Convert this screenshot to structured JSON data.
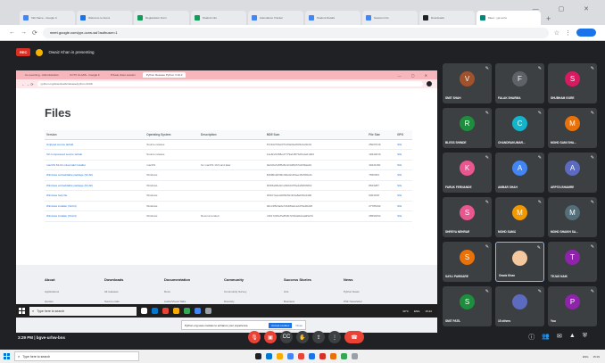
{
  "browser": {
    "tabs": [
      {
        "label": "Tab Name - Google C",
        "color": "#4285f4"
      },
      {
        "label": "Welcome to Arena",
        "color": "#1a73e8"
      },
      {
        "label": "Registration Form",
        "color": "#0f9d58"
      },
      {
        "label": "Student info",
        "color": "#0f9d58"
      },
      {
        "label": "Attendance Tracker",
        "color": "#4285f4"
      },
      {
        "label": "Student Details",
        "color": "#4285f4"
      },
      {
        "label": "Session Info",
        "color": "#4285f4"
      },
      {
        "label": "Downloads",
        "color": "#202124"
      },
      {
        "label": "Meet - ypr-ocrw",
        "color": "#00897b",
        "active": true
      }
    ],
    "url": "meet.google.com/ypr-ocrw-ssl?authuser=1"
  },
  "meet": {
    "rec_label": "REC",
    "presenting_text": "Owaiz Khan is presenting",
    "time_label": "3:29 PM | bgve-urhw-bns",
    "participants": [
      {
        "initial": "V",
        "name": "SMIT SHAH",
        "color": "#a0522d"
      },
      {
        "initial": "F",
        "name": "FALAK SHARMA",
        "color": "#5f6368"
      },
      {
        "initial": "S",
        "name": "SHUBHAM GORE",
        "color": "#d81b60"
      },
      {
        "initial": "R",
        "name": "BLESS SHINDE",
        "color": "#1e8e3e"
      },
      {
        "initial": "C",
        "name": "CHANDRAKUMAR...",
        "color": "#12b5cb"
      },
      {
        "initial": "M",
        "name": "MOHD SAMI SHA...",
        "color": "#e8710a"
      },
      {
        "initial": "K",
        "name": "FARUK FERNANDE",
        "color": "#e8578f"
      },
      {
        "initial": "A",
        "name": "AMBAR SHAH",
        "color": "#4285f4"
      },
      {
        "initial": "A",
        "name": "ARPITA BHAMRE",
        "color": "#5c6bc0"
      },
      {
        "initial": "S",
        "name": "SHREYA NEHRAR",
        "color": "#e8578f"
      },
      {
        "initial": "M",
        "name": "MOHD SAMIJ",
        "color": "#f29900"
      },
      {
        "initial": "M",
        "name": "MOHD SHAIKH SA...",
        "color": "#546e7a"
      },
      {
        "initial": "S",
        "name": "SAYLI PAWSARE",
        "color": "#e8710a"
      },
      {
        "initial": "",
        "name": "Owaiz Khan",
        "color": "#f5c9a0"
      },
      {
        "initial": "T",
        "name": "TEJAS NAIK",
        "color": "#8e24aa"
      },
      {
        "initial": "S",
        "name": "SMIT PATIL",
        "color": "#1e8e3e"
      },
      {
        "initial": "",
        "name": "15 others",
        "color": "#5c6bc0"
      },
      {
        "initial": "P",
        "name": "You",
        "color": "#8e24aa"
      }
    ]
  },
  "shared_screen": {
    "tabs": [
      {
        "label": "Co-Learning - Administration"
      },
      {
        "label": "CCTV CLASS - Google F"
      },
      {
        "label": "Private class session"
      },
      {
        "label": "Python Release Python 3.10.2",
        "active": true
      }
    ],
    "url": "python.org/downloads/release/python-3102/",
    "heading": "Files",
    "columns": [
      "Version",
      "Operating System",
      "Description",
      "MD5 Sum",
      "File Size",
      "GPG"
    ],
    "rows": [
      [
        "Gzipped source tarball",
        "Source release",
        "",
        "67c92270be6701f4a6fed003c2af3c01",
        "25007016",
        "SIG"
      ],
      [
        "XZ compressed source tarball",
        "Source release",
        "",
        "14e8c22458ed7779a1957b26cde01db9",
        "19342616",
        "SIG"
      ],
      [
        "macOS 64-bit universal2 installer",
        "macOS",
        "for macOS 10.9 and later",
        "0a3c0a7a5f5d6c4c3a5f2b7cd0f3aa91",
        "40441160",
        "SIG"
      ],
      [
        "Windows embeddable package (32-bit)",
        "Windows",
        "",
        "fb8d8bd2f36b4b6a0cc83ee45c8b5a11",
        "7656453",
        "SIG"
      ],
      [
        "Windows embeddable package (64-bit)",
        "Windows",
        "",
        "0f4b5ab8e9c1c9b04d7f6e4a63f0b6b2",
        "8633287",
        "SIG"
      ],
      [
        "Windows help file",
        "Windows",
        "",
        "3f41b7a1e3d0f9c6fc4b3a8ab54c2d90",
        "9364158",
        "SIG"
      ],
      [
        "Windows installer (32-bit)",
        "Windows",
        "",
        "0d1c3f5c3a6e72b4f8a4ce2d79a30d18",
        "27785192",
        "SIG"
      ],
      [
        "Windows installer (64-bit)",
        "Windows",
        "Recommended",
        "c3917c08a7fe85db7203da6dcaa99a70",
        "28991832",
        "SIG"
      ]
    ],
    "footer_columns": [
      {
        "title": "About",
        "links": [
          "Applications",
          "Quotes"
        ]
      },
      {
        "title": "Downloads",
        "links": [
          "All releases",
          "Source code"
        ]
      },
      {
        "title": "Documentation",
        "links": [
          "Docs",
          "Audio/Visual Talks"
        ]
      },
      {
        "title": "Community",
        "links": [
          "Community Survey",
          "Diversity"
        ]
      },
      {
        "title": "Success Stories",
        "links": [
          "Arts",
          "Business"
        ]
      },
      {
        "title": "News",
        "links": [
          "Python News",
          "PSF Newsletter"
        ]
      }
    ],
    "cookie_text": "Python.org uses cookies to enhance your experience.",
    "cookie_accept": "Accept cookies",
    "cookie_close": "Close",
    "taskbar_search": "Type here to search",
    "taskbar_tray": [
      "30°C",
      "ENG",
      "15:22"
    ]
  },
  "os_taskbar": {
    "search_placeholder": "Type here to search",
    "tray": [
      "ENG",
      "15:29"
    ]
  }
}
